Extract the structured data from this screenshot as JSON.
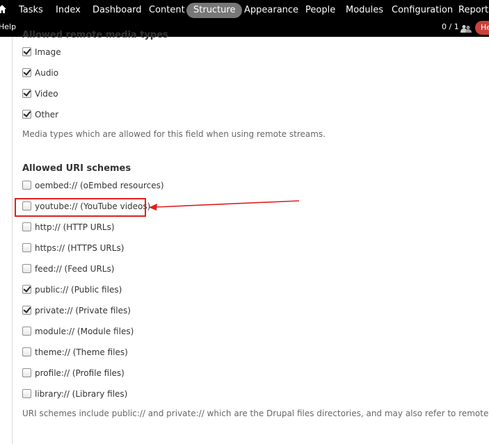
{
  "toolbar": {
    "menu": [
      "Tasks",
      "Index",
      "Dashboard",
      "Content",
      "Structure",
      "Appearance",
      "People",
      "Modules",
      "Configuration",
      "Reports"
    ],
    "active": "Structure",
    "help": "Help",
    "counter": "0 / 1",
    "hello": "He"
  },
  "media_types": {
    "title": "Allowed remote media types",
    "items": [
      {
        "label": "Image",
        "checked": true
      },
      {
        "label": "Audio",
        "checked": true
      },
      {
        "label": "Video",
        "checked": true
      },
      {
        "label": "Other",
        "checked": true
      }
    ],
    "description": "Media types which are allowed for this field when using remote streams."
  },
  "uri_schemes": {
    "title": "Allowed URI schemes",
    "items": [
      {
        "label": "oembed:// (oEmbed resources)",
        "checked": false
      },
      {
        "label": "youtube:// (YouTube videos)",
        "checked": false
      },
      {
        "label": "http:// (HTTP URLs)",
        "checked": false
      },
      {
        "label": "https:// (HTTPS URLs)",
        "checked": false
      },
      {
        "label": "feed:// (Feed URLs)",
        "checked": false
      },
      {
        "label": "public:// (Public files)",
        "checked": true
      },
      {
        "label": "private:// (Private files)",
        "checked": true
      },
      {
        "label": "module:// (Module files)",
        "checked": false
      },
      {
        "label": "theme:// (Theme files)",
        "checked": false
      },
      {
        "label": "profile:// (Profile files)",
        "checked": false
      },
      {
        "label": "library:// (Library files)",
        "checked": false
      }
    ],
    "description": "URI schemes include public:// and private:// which are the Drupal files directories, and may also refer to remote sites."
  },
  "annotation": {
    "color": "#e0201e"
  }
}
